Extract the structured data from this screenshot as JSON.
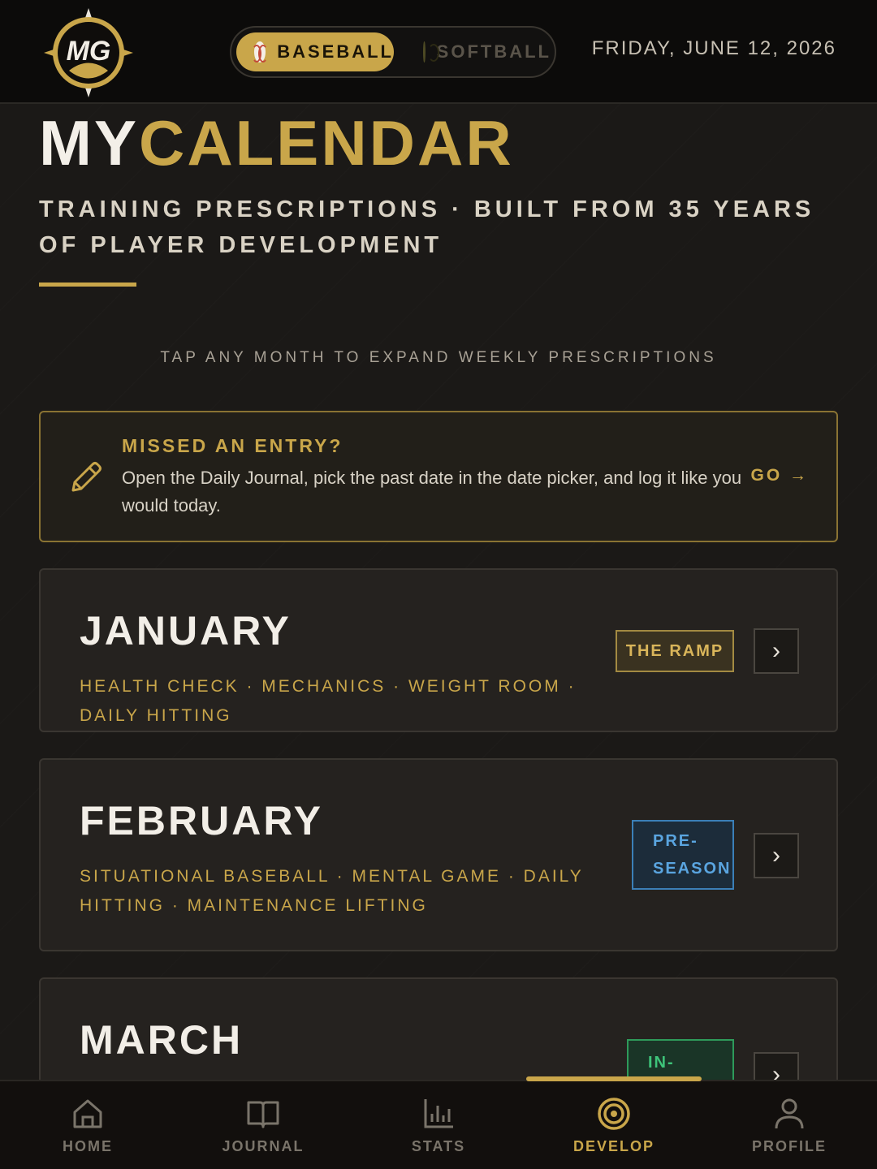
{
  "header": {
    "sport_toggle": {
      "active_label": "BASEBALL",
      "inactive_label": "SOFTBALL"
    },
    "date": "FRIDAY, JUNE 12, 2026"
  },
  "page": {
    "title_part1": "MY",
    "title_part2": "CALENDAR",
    "subtitle": "TRAINING PRESCRIPTIONS · BUILT FROM 35 YEARS OF PLAYER DEVELOPMENT",
    "hint": "TAP ANY MONTH TO EXPAND WEEKLY PRESCRIPTIONS"
  },
  "missed_entry": {
    "title": "MISSED AN ENTRY?",
    "body": "Open the Daily Journal, pick the past date in the date picker, and log it like you would today.",
    "action": "GO →"
  },
  "months": [
    {
      "name": "JANUARY",
      "tags": "HEALTH CHECK · MECHANICS · WEIGHT ROOM · DAILY HITTING",
      "phase": "THE RAMP",
      "phase_color": "#c9a64a"
    },
    {
      "name": "FEBRUARY",
      "tags": "SITUATIONAL BASEBALL · MENTAL GAME · DAILY HITTING · MAINTENANCE LIFTING",
      "phase": "PRE- SEASON",
      "phase_color": "#5aa5e0"
    },
    {
      "name": "MARCH",
      "tags": "",
      "phase": "IN-",
      "phase_color": "#3ec47a"
    }
  ],
  "nav": {
    "items": [
      {
        "label": "HOME",
        "icon": "home-icon"
      },
      {
        "label": "JOURNAL",
        "icon": "book-icon"
      },
      {
        "label": "STATS",
        "icon": "bar-chart-icon"
      },
      {
        "label": "DEVELOP",
        "icon": "target-icon"
      },
      {
        "label": "PROFILE",
        "icon": "user-icon"
      }
    ],
    "active_index": 3
  },
  "colors": {
    "accent": "#c9a64a",
    "background": "#1b1917",
    "header_bg": "#0c0b0a"
  }
}
